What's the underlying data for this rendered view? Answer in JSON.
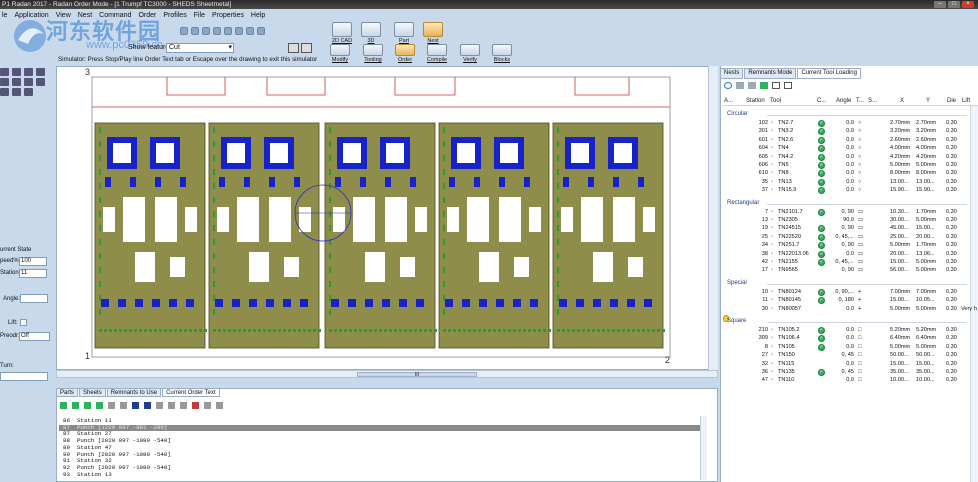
{
  "titlebar": {
    "title": "P1 Radan 2017 - Radan Order Mode - [1 Trumpf TC3000 - SHEDS Sheetmetal]"
  },
  "watermark": {
    "line1": "河东软件园",
    "line2": "www.pc0359.cn"
  },
  "menu": [
    "le",
    "Application",
    "View",
    "Nest",
    "Command",
    "Order",
    "Profiles",
    "File",
    "Properties",
    "Help"
  ],
  "toolbar": {
    "feature_label": "Show features",
    "feature_value": "Cut"
  },
  "simulator_hint": "Simulator: Press Stop/Play line Order Text tab or Escape over the drawing to exit this simulator",
  "ribbon": [
    {
      "label": "2D CAD",
      "active": false
    },
    {
      "label": "3D",
      "active": false
    },
    {
      "label": "Part",
      "active": false
    },
    {
      "label": "Nest",
      "active": true
    },
    {
      "label": "Modify",
      "active": false
    },
    {
      "label": "Tooling",
      "active": false
    },
    {
      "label": "Order",
      "active": true
    },
    {
      "label": "Compile",
      "active": false
    },
    {
      "label": "Verify",
      "active": false
    },
    {
      "label": "Blocks",
      "active": false
    }
  ],
  "left_panel": {
    "state_label": "urrent State",
    "speed_label": "peed%:",
    "speed_value": "100",
    "station_label": "Station:",
    "station_value": "11",
    "angle_label": "Angle:",
    "lift_label": "Lift:",
    "preorder_label": "Preodr:",
    "preorder_value": "Off",
    "turn_label": "Turn:"
  },
  "canvas": {
    "ruler_top": "3",
    "ruler_bottom_left": "1",
    "ruler_bottom_right": "2",
    "ruler_right": "1"
  },
  "scrollbar": {
    "grip": "III"
  },
  "bottom_tabs": [
    "Parts",
    "Sheets",
    "Remnants to Use",
    "Current Order Text"
  ],
  "bottom_active_tab": "Current Order Text",
  "order_text": [
    {
      "num": "86",
      "text": "Station 11"
    },
    {
      "num": "87",
      "text": "Punch [1229 997 -891 -290]",
      "selected": true
    },
    {
      "num": "87",
      "text": "Station 27"
    },
    {
      "num": "88",
      "text": "Punch [2020 997 -1080 -540]"
    },
    {
      "num": "89",
      "text": "Station 47"
    },
    {
      "num": "90",
      "text": "Punch [2020 997 -1080 -540]"
    },
    {
      "num": "91",
      "text": "Station 32"
    },
    {
      "num": "92",
      "text": "Punch [2020 997 -1080 -540]"
    },
    {
      "num": "93",
      "text": "Station 13"
    }
  ],
  "right_tabs": [
    "Nests",
    "Remnants Mode",
    "Current Tool Loading"
  ],
  "right_active_tab": "Current Tool Loading",
  "columns": {
    "a": "A...",
    "station": "Station",
    "tool": "Tool",
    "c": "C...",
    "angle": "Angle",
    "t": "T...",
    "s": "S...",
    "x": "X",
    "y": "Y",
    "die": "Die",
    "lift": "Lift"
  },
  "tool_groups": [
    {
      "name": "Circular",
      "rows": [
        {
          "station": "102",
          "tool": "TN2.7",
          "check": true,
          "angle": "0.0",
          "shape": "○",
          "x": "2.70mm",
          "y": "2.70mm",
          "die": "0.30"
        },
        {
          "station": "301",
          "tool": "TN3.2",
          "check": true,
          "angle": "0.0",
          "shape": "○",
          "x": "3.20mm",
          "y": "3.20mm",
          "die": "0.30"
        },
        {
          "station": "601",
          "tool": "TN2.6",
          "check": true,
          "angle": "0.0",
          "shape": "○",
          "x": "2.60mm",
          "y": "2.60mm",
          "die": "0.30"
        },
        {
          "station": "604",
          "tool": "TN4",
          "check": true,
          "angle": "0.0",
          "shape": "○",
          "x": "4.00mm",
          "y": "4.00mm",
          "die": "0.30"
        },
        {
          "station": "605",
          "tool": "TN4.2",
          "check": true,
          "angle": "0.0",
          "shape": "○",
          "x": "4.20mm",
          "y": "4.20mm",
          "die": "0.30"
        },
        {
          "station": "606",
          "tool": "TN5",
          "check": true,
          "angle": "0.0",
          "shape": "○",
          "x": "5.00mm",
          "y": "5.00mm",
          "die": "0.30"
        },
        {
          "station": "610",
          "tool": "TN8",
          "check": true,
          "angle": "0.0",
          "shape": "○",
          "x": "8.00mm",
          "y": "8.00mm",
          "die": "0.30"
        },
        {
          "station": "35",
          "tool": "TN13",
          "check": true,
          "angle": "0.0",
          "shape": "○",
          "x": "13.00...",
          "y": "13.00...",
          "die": "0.30"
        },
        {
          "station": "37",
          "tool": "TN15.9",
          "check": true,
          "angle": "0.0",
          "shape": "○",
          "x": "15.90...",
          "y": "15.90...",
          "die": "0.30"
        }
      ]
    },
    {
      "name": "Rectangular",
      "rows": [
        {
          "station": "7",
          "tool": "TN2101.7",
          "check": true,
          "angle": "0, 90",
          "shape": "▭",
          "x": "10.30...",
          "y": "1.70mm",
          "die": "0.30"
        },
        {
          "station": "13",
          "tool": "TN2305",
          "check": false,
          "angle": "90.0",
          "shape": "▭",
          "x": "30.00...",
          "y": "5.00mm",
          "die": "0.30"
        },
        {
          "station": "19",
          "tool": "TN24515",
          "check": true,
          "angle": "0, 90",
          "shape": "▭",
          "x": "45.00...",
          "y": "15.00...",
          "die": "0.30"
        },
        {
          "station": "25",
          "tool": "TN22520",
          "check": true,
          "angle": "0, 45,...",
          "shape": "▭",
          "x": "25.00...",
          "y": "20.00...",
          "die": "0.30"
        },
        {
          "station": "34",
          "tool": "TN251.7",
          "check": true,
          "angle": "0, 90",
          "shape": "▭",
          "x": "5.00mm",
          "y": "1.70mm",
          "die": "0.30"
        },
        {
          "station": "38",
          "tool": "TN22013.06",
          "check": true,
          "angle": "0.0",
          "shape": "▭",
          "x": "20.00...",
          "y": "13.06...",
          "die": "0.30"
        },
        {
          "station": "42",
          "tool": "TN2155",
          "check": true,
          "angle": "0, 45,...",
          "shape": "▭",
          "x": "15.00...",
          "y": "5.00mm",
          "die": "0.30"
        },
        {
          "station": "17",
          "tool": "TN9565",
          "check": false,
          "angle": "0, 90",
          "shape": "▭",
          "x": "56.00...",
          "y": "5.00mm",
          "die": "0.30"
        }
      ]
    },
    {
      "name": "Special",
      "rows": [
        {
          "station": "10",
          "tool": "TN80124",
          "check": true,
          "angle": "0, 90,...",
          "shape": "+",
          "x": "7.00mm",
          "y": "7.00mm",
          "die": "0.30"
        },
        {
          "station": "11",
          "tool": "TN80145",
          "check": true,
          "angle": "0, 180",
          "shape": "+",
          "x": "15.00...",
          "y": "10.05...",
          "die": "0.30"
        },
        {
          "station": "30",
          "tool": "TN80057",
          "check": false,
          "angle": "0.0",
          "shape": "+",
          "x": "5.00mm",
          "y": "5.00mm",
          "die": "0.30",
          "lift": "Very h"
        }
      ]
    },
    {
      "name": "Square",
      "rows": [
        {
          "station": "210",
          "tool": "TN105.2",
          "check": true,
          "angle": "0.0",
          "shape": "□",
          "x": "5.20mm",
          "y": "5.20mm",
          "die": "0.30"
        },
        {
          "station": "309",
          "tool": "TN106.4",
          "check": true,
          "angle": "0.0",
          "shape": "□",
          "x": "6.40mm",
          "y": "6.40mm",
          "die": "0.30"
        },
        {
          "station": "8",
          "tool": "TN105",
          "check": true,
          "angle": "0.0",
          "shape": "□",
          "x": "5.00mm",
          "y": "5.00mm",
          "die": "0.30"
        },
        {
          "station": "27",
          "tool": "TN150",
          "check": false,
          "angle": "0, 45",
          "shape": "□",
          "x": "50.00...",
          "y": "50.00...",
          "die": "0.30"
        },
        {
          "station": "32",
          "tool": "TN115",
          "check": false,
          "angle": "0.0",
          "shape": "□",
          "x": "15.00...",
          "y": "15.00...",
          "die": "0.30"
        },
        {
          "station": "36",
          "tool": "TN135",
          "check": true,
          "angle": "0, 45",
          "shape": "□",
          "x": "35.00...",
          "y": "35.00...",
          "die": "0.30"
        },
        {
          "station": "47",
          "tool": "TN110",
          "check": false,
          "angle": "0.0",
          "shape": "□",
          "x": "10.00...",
          "y": "10.00...",
          "die": "0.30"
        }
      ]
    }
  ],
  "colors": {
    "accent": "#2a7ad0",
    "part_fill": "#8e8d4a",
    "hole_fill": "#1722c8",
    "selected_row": "#8a8a8a",
    "ok": "#2fb25a"
  }
}
